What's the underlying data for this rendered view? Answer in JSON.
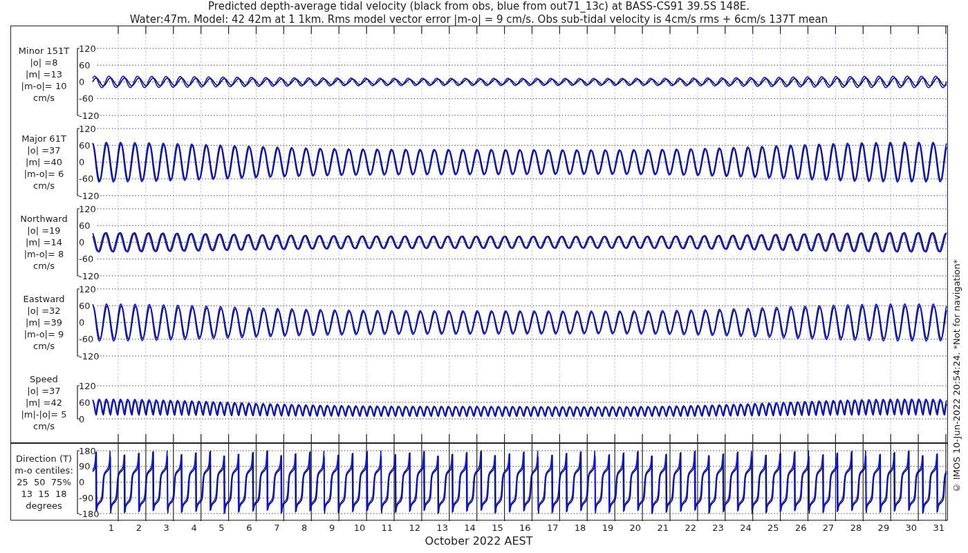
{
  "title_lines": [
    "Predicted depth-average tidal velocity (black from obs, blue from out71_13c) at BASS-CS91 39.5S 148E.",
    "Water:47m. Model: 42 42m at 1 1km. Rms model vector error |m-o| = 9 cm/s. Obs sub-tidal velocity is 4cm/s rms + 6cm/s 137T mean"
  ],
  "panels": [
    {
      "kind": "minor",
      "label_lines": [
        "Minor 151T",
        "|o| =8",
        "|m| =13",
        "|m-o|= 10",
        "cm/s"
      ],
      "yticks": [
        "120",
        "60",
        "0",
        "-60",
        "-120"
      ]
    },
    {
      "kind": "major",
      "label_lines": [
        "Major 61T",
        "|o| =37",
        "|m| =40",
        "|m-o|= 6",
        "cm/s"
      ],
      "yticks": [
        "120",
        "60",
        "0",
        "-60",
        "-120"
      ]
    },
    {
      "kind": "north",
      "label_lines": [
        "Northward",
        "|o| =19",
        "|m| =14",
        "|m-o|= 8",
        "cm/s"
      ],
      "yticks": [
        "120",
        "60",
        "0",
        "-60",
        "-120"
      ]
    },
    {
      "kind": "east",
      "label_lines": [
        "Eastward",
        "|o| =32",
        "|m| =39",
        "|m-o|= 9",
        "cm/s"
      ],
      "yticks": [
        "120",
        "60",
        "0",
        "-60",
        "-120"
      ]
    },
    {
      "kind": "speed",
      "label_lines": [
        "Speed",
        "|o| =37",
        "|m| =42",
        "|m|-|o|= 5",
        "cm/s"
      ],
      "yticks": [
        "120",
        "60",
        "0"
      ]
    },
    {
      "kind": "direction",
      "label_lines": [
        "Direction (T)",
        "m-o centiles:",
        "25  50  75%",
        "13  15  18",
        "degrees"
      ],
      "yticks": [
        "180",
        "90",
        "0",
        "-90",
        "-180"
      ]
    }
  ],
  "x_labels": [
    "1",
    "2",
    "3",
    "4",
    "5",
    "6",
    "7",
    "8",
    "9",
    "10",
    "11",
    "12",
    "13",
    "14",
    "15",
    "16",
    "17",
    "18",
    "19",
    "20",
    "21",
    "22",
    "23",
    "24",
    "25",
    "26",
    "27",
    "28",
    "29",
    "30",
    "31"
  ],
  "x_title": "October 2022 AEST",
  "side_note": "© IMOS 10-Jun-2022 20:54:24. *Not for navigation*"
}
